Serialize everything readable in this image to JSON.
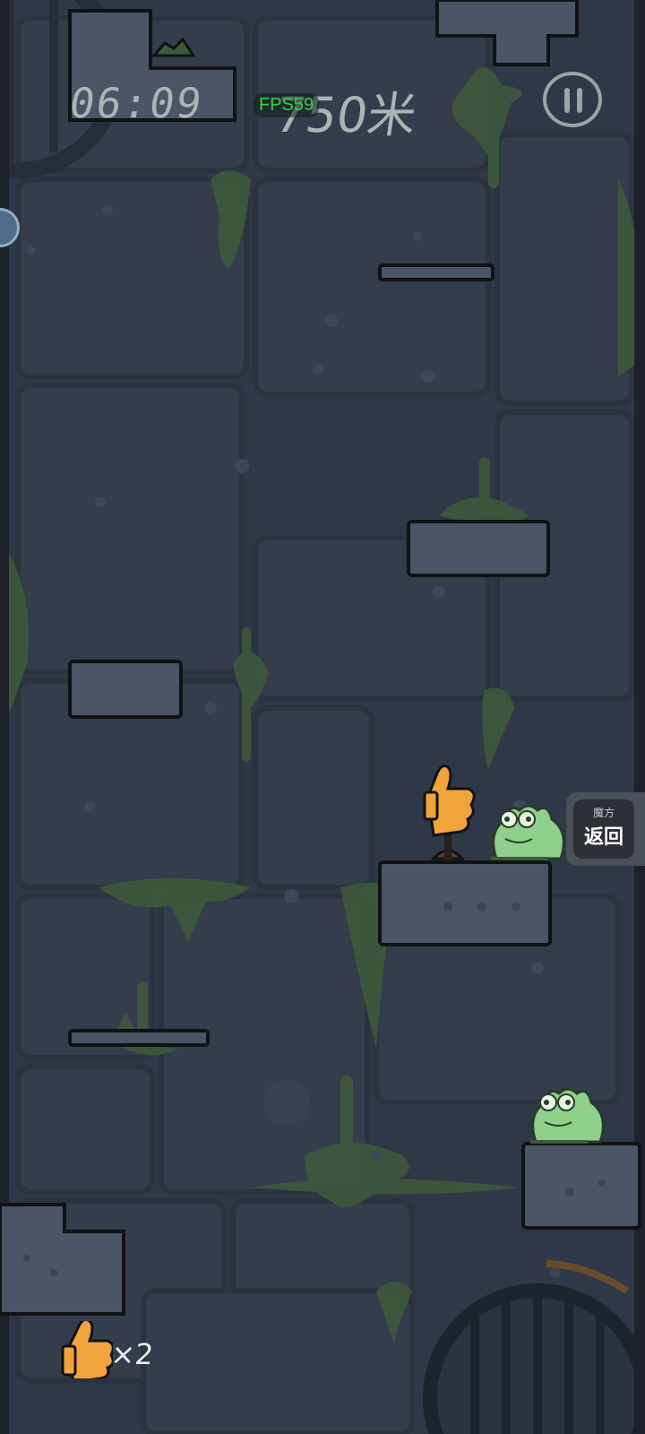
{
  "hud": {
    "timer": "06:09",
    "fps": "FPS59",
    "distance": "750米",
    "pause_icon": "pause-icon"
  },
  "overlay": {
    "return_button_sub": "魔方",
    "return_button_label": "返回"
  },
  "inventory": {
    "item_icon": "thumbs-up-icon",
    "count_label": "×2"
  },
  "colors": {
    "background": "#2f3846",
    "stone": "#4a5566",
    "outline": "#101214",
    "slime": "#3e5a3a",
    "frog": "#8fd08a",
    "thumb": "#f0a43a",
    "fps_text": "#33d04a"
  }
}
